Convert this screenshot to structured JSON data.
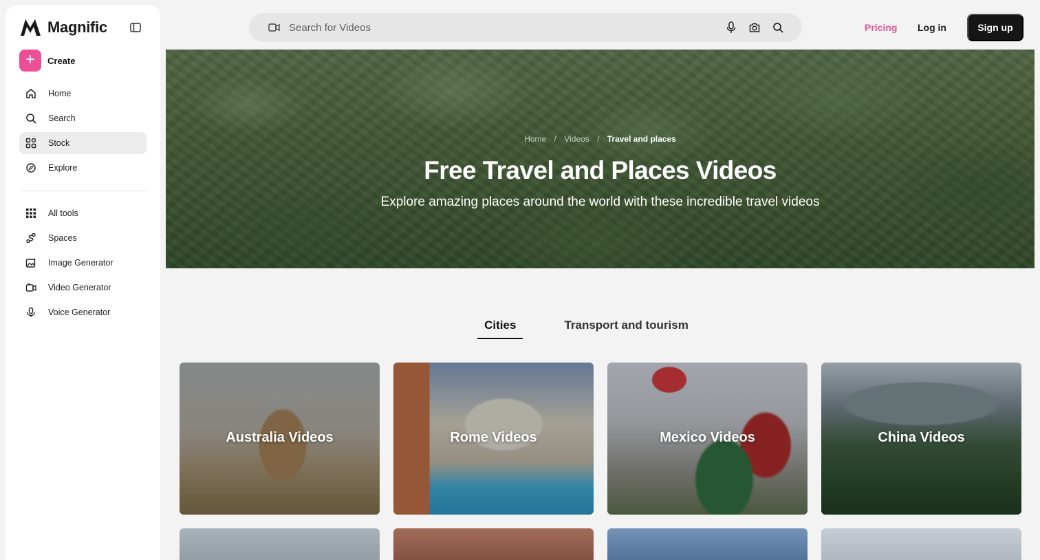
{
  "brand": {
    "name": "Magnific"
  },
  "sidebar": {
    "create_label": "Create",
    "primary": [
      {
        "label": "Home",
        "icon": "home-icon"
      },
      {
        "label": "Search",
        "icon": "search-icon"
      },
      {
        "label": "Stock",
        "icon": "grid-icon",
        "active": true
      },
      {
        "label": "Explore",
        "icon": "compass-icon"
      }
    ],
    "tools": [
      {
        "label": "All tools",
        "icon": "dots-grid-icon"
      },
      {
        "label": "Spaces",
        "icon": "spaces-icon"
      },
      {
        "label": "Image Generator",
        "icon": "image-generator-icon"
      },
      {
        "label": "Video Generator",
        "icon": "video-generator-icon"
      },
      {
        "label": "Voice Generator",
        "icon": "microphone-icon"
      }
    ]
  },
  "topbar": {
    "search_placeholder": "Search for Videos",
    "pricing": "Pricing",
    "login": "Log in",
    "signup": "Sign up"
  },
  "hero": {
    "breadcrumb": [
      "Home",
      "Videos",
      "Travel and places"
    ],
    "separator": "/",
    "title": "Free Travel and Places Videos",
    "subtitle": "Explore amazing places around the world with these incredible travel videos"
  },
  "tabs": [
    {
      "label": "Cities",
      "active": true
    },
    {
      "label": "Transport and tourism",
      "active": false
    }
  ],
  "cards": [
    {
      "label": "Australia Videos"
    },
    {
      "label": "Rome Videos"
    },
    {
      "label": "Mexico Videos"
    },
    {
      "label": "China Videos"
    }
  ],
  "colors": {
    "accent": "#ec4f95",
    "pricing": "#e0579a",
    "signup_bg": "#151515"
  }
}
